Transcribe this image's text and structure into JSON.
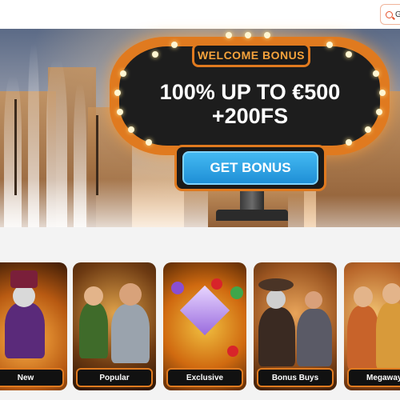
{
  "header": {
    "search_label": "G"
  },
  "hero": {
    "badge": "WELCOME BONUS",
    "headline_line1": "100% UP TO €500",
    "headline_line2": "+200FS",
    "cta_label": "GET BONUS"
  },
  "categories": [
    {
      "label": "New"
    },
    {
      "label": "Popular"
    },
    {
      "label": "Exclusive"
    },
    {
      "label": "Bonus Buys"
    },
    {
      "label": "Megaways"
    }
  ],
  "colors": {
    "accent_orange": "#e07a1f",
    "cta_blue": "#2aa3e6",
    "sign_text": "#f5a33c"
  }
}
